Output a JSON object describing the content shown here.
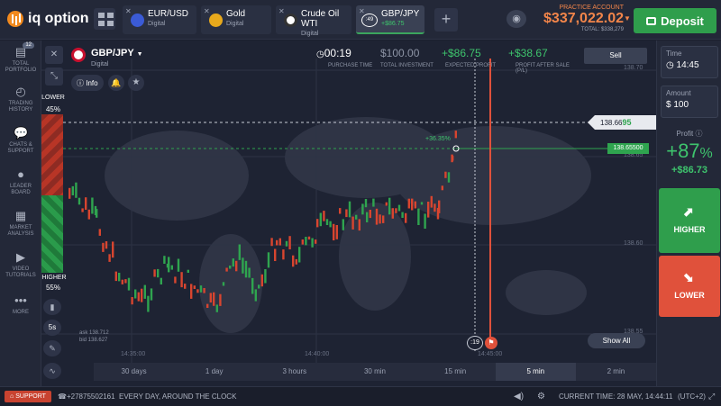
{
  "app": {
    "name": "iq option"
  },
  "tabs": [
    {
      "name": "EUR/USD",
      "sub": "Digital",
      "color": "#3b5bd6"
    },
    {
      "name": "Gold",
      "sub": "Digital",
      "color": "#e8a91c"
    },
    {
      "name": "Crude Oil WTI",
      "sub": "Digital",
      "color": "#1a1a1a"
    },
    {
      "name": "GBP/JPY",
      "sub": "+$86.75",
      "timer": ":49",
      "active": true
    }
  ],
  "account": {
    "label": "PRACTICE ACCOUNT",
    "balance": "$337,022.02",
    "total": "TOTAL: $338,279"
  },
  "deposit": "Deposit",
  "sidebar": [
    {
      "label": "TOTAL PORTFOLIO",
      "icon": "portfolio-icon",
      "badge": "12"
    },
    {
      "label": "TRADING HISTORY",
      "icon": "history-icon"
    },
    {
      "label": "CHATS & SUPPORT",
      "icon": "chat-icon"
    },
    {
      "label": "LEADER BOARD",
      "icon": "leaderboard-icon"
    },
    {
      "label": "MARKET ANALYSIS",
      "icon": "news-icon"
    },
    {
      "label": "VIDEO TUTORIALS",
      "icon": "play-icon"
    },
    {
      "label": "MORE",
      "icon": "more-icon"
    }
  ],
  "asset": {
    "name": "GBP/JPY",
    "type": "Digital",
    "info": "Info"
  },
  "stats": {
    "purchase_time": {
      "value": "00:19",
      "label": "PURCHASE TIME"
    },
    "investment": {
      "value": "$100.00",
      "label": "TOTAL INVESTMENT"
    },
    "expected": {
      "value": "+$86.75",
      "label": "EXPECTED PROFIT"
    },
    "profit_after": {
      "value": "+$38.67",
      "label": "PROFIT AFTER SALE (P/L)"
    }
  },
  "sell": "Sell",
  "traders": {
    "lower_label": "LOWER",
    "lower_pct": "45%",
    "higher_label": "HIGHER",
    "higher_pct": "55%"
  },
  "price_axis": {
    "ticks": [
      "138.70",
      "138.65",
      "138.60",
      "138.55"
    ],
    "current_main": "138.66",
    "current_tail": "95",
    "strike": "138.65500",
    "deal_pct": "+36.35%"
  },
  "time_axis": [
    "14:35:00",
    "14:40:00",
    "14:45:00"
  ],
  "ask_bid": {
    "ask": "ask 138.712",
    "bid": "bid 138.627"
  },
  "timer_marker": ":19",
  "show_all": "Show All",
  "tool_btns": {
    "timeframe": "5s"
  },
  "timeframes": [
    "30 days",
    "1 day",
    "3 hours",
    "30 min",
    "15 min",
    "5 min",
    "2 min"
  ],
  "active_timeframe": "5 min",
  "right": {
    "time_label": "Time",
    "time": "14:45",
    "amount_label": "Amount",
    "amount": "$ 100",
    "profit_label": "Profit",
    "profit_pct": "+87",
    "profit_pct_unit": "%",
    "profit_value": "+$86.73",
    "higher": "HIGHER",
    "lower": "LOWER"
  },
  "footer": {
    "support": "SUPPORT",
    "phone": "+27875502161",
    "slogan": "EVERY DAY, AROUND THE CLOCK",
    "time": "CURRENT TIME: 28 MAY, 14:44:11",
    "tz": "(UTC+2)"
  },
  "colors": {
    "up": "#2fa44f",
    "down": "#d8452f",
    "accent": "#f2854a"
  }
}
